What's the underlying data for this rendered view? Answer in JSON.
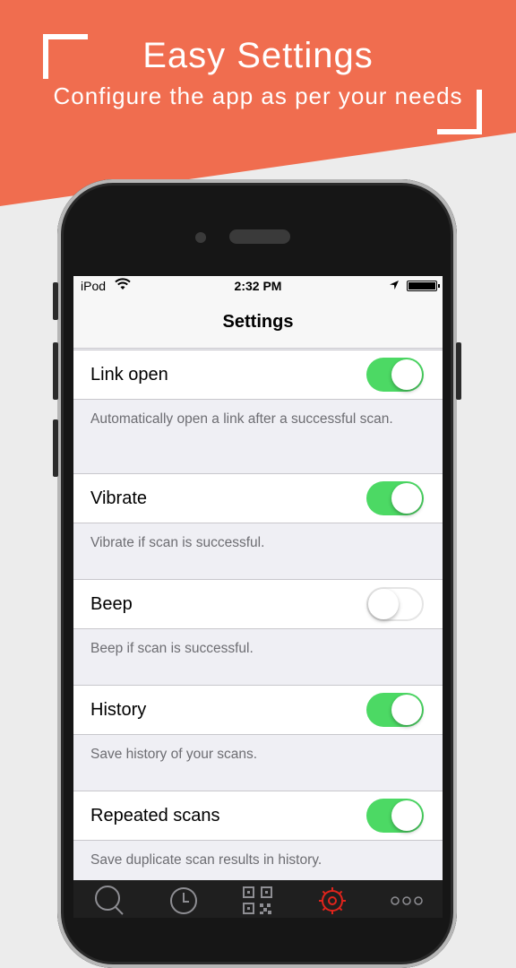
{
  "promo": {
    "title": "Easy Settings",
    "subtitle": "Configure the app as per your needs"
  },
  "statusbar": {
    "carrier": "iPod",
    "time": "2:32 PM"
  },
  "nav": {
    "title": "Settings"
  },
  "settings": [
    {
      "label": "Link open",
      "enabled": true,
      "description": "Automatically open a link after a successful scan."
    },
    {
      "label": "Vibrate",
      "enabled": true,
      "description": "Vibrate if scan is successful."
    },
    {
      "label": "Beep",
      "enabled": false,
      "description": "Beep if scan is successful."
    },
    {
      "label": "History",
      "enabled": true,
      "description": "Save history of your scans."
    },
    {
      "label": "Repeated scans",
      "enabled": true,
      "description": "Save duplicate scan results in history."
    }
  ],
  "tabbar": {
    "items": [
      "search-icon",
      "clock-icon",
      "qr-code-icon",
      "gear-icon",
      "more-icon"
    ],
    "active": "gear-icon"
  },
  "colors": {
    "banner": "#f06d4f",
    "switch_on": "#4cd964",
    "active_tab": "#e0241c"
  }
}
